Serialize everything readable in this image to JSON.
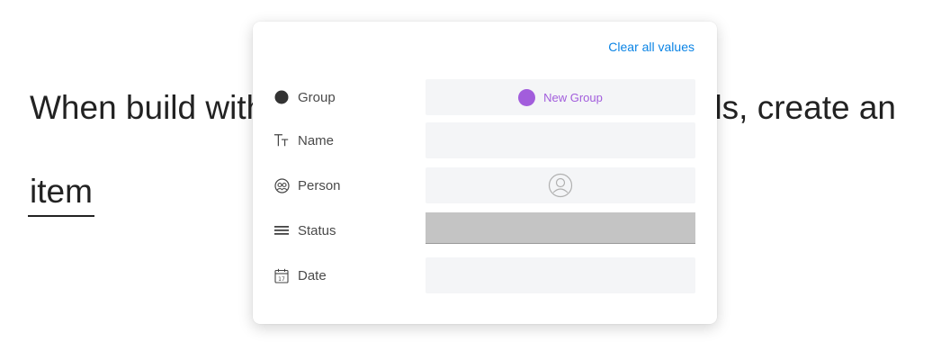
{
  "background_text": {
    "line1_left": "When build with",
    "line1_right": "ils, create an",
    "line2": "item"
  },
  "popup": {
    "clear_all_label": "Clear all values",
    "fields": [
      {
        "label": "Group",
        "icon": "filled-circle-icon"
      },
      {
        "label": "Name",
        "icon": "text-type-icon"
      },
      {
        "label": "Person",
        "icon": "people-circle-icon"
      },
      {
        "label": "Status",
        "icon": "lines-icon"
      },
      {
        "label": "Date",
        "icon": "calendar-icon"
      }
    ],
    "group_value": {
      "name": "New Group",
      "color": "#a25ddc"
    },
    "person_value": {
      "icon": "empty-avatar-icon"
    },
    "date_icon_day": "17"
  },
  "colors": {
    "link": "#0b84e5",
    "status_empty": "#c4c4c4"
  }
}
